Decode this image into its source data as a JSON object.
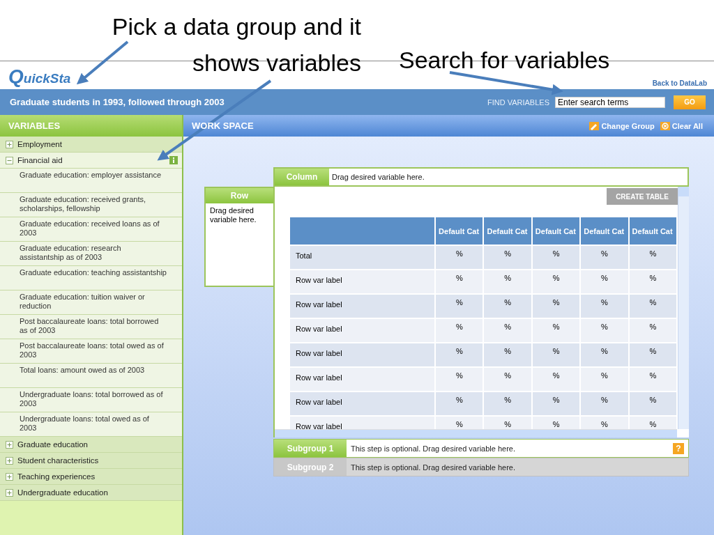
{
  "annotations": [
    {
      "kind": "group",
      "lines": [
        "Pick a data group and it",
        "shows variables"
      ]
    },
    {
      "kind": "search",
      "lines": [
        "Search for variables"
      ]
    }
  ],
  "logo": "QuickSta",
  "back_link": "Back to DataLab",
  "dataset_title": "Graduate students in 1993, followed through 2003",
  "find": {
    "label": "FIND VARIABLES",
    "value": "Enter search terms",
    "button": "GO"
  },
  "variables": {
    "title": "VARIABLES",
    "groups": [
      {
        "label": "Employment",
        "expanded": false
      },
      {
        "label": "Financial aid",
        "expanded": true,
        "children": [
          "Graduate education: employer assistance",
          "Graduate education: received grants, scholarships, fellowship",
          "Graduate education: received loans as of 2003",
          "Graduate education: research assistantship as of 2003",
          "Graduate education: teaching assistantship",
          "Graduate education: tuition waiver or reduction",
          "Post baccalaureate loans: total borrowed as of 2003",
          "Post baccalaureate loans: total owed as of 2003",
          "Total loans: amount owed as of 2003",
          "Undergraduate loans: total borrowed as of 2003",
          "Undergraduate loans: total owed as of 2003"
        ]
      },
      {
        "label": "Graduate education",
        "expanded": false
      },
      {
        "label": "Student characteristics",
        "expanded": false
      },
      {
        "label": "Teaching experiences",
        "expanded": false
      },
      {
        "label": "Undergraduate education",
        "expanded": false
      }
    ]
  },
  "workspace": {
    "title": "WORK SPACE",
    "actions": [
      {
        "kind": "change",
        "label": "Change Group"
      },
      {
        "kind": "clear",
        "label": "Clear All"
      }
    ],
    "column": {
      "label": "Column",
      "hint": "Drag desired variable here."
    },
    "row": {
      "label": "Row",
      "hint": "Drag desired variable here."
    },
    "create_table": "CREATE TABLE",
    "table": {
      "columns": [
        "Default Cat",
        "Default Cat",
        "Default Cat",
        "Default Cat",
        "Default Cat"
      ],
      "rows": [
        {
          "label": "Total",
          "cells": [
            "%",
            "%",
            "%",
            "%",
            "%"
          ]
        },
        {
          "label": "Row var label",
          "cells": [
            "%",
            "%",
            "%",
            "%",
            "%"
          ]
        },
        {
          "label": "Row var label",
          "cells": [
            "%",
            "%",
            "%",
            "%",
            "%"
          ]
        },
        {
          "label": "Row var label",
          "cells": [
            "%",
            "%",
            "%",
            "%",
            "%"
          ]
        },
        {
          "label": "Row var label",
          "cells": [
            "%",
            "%",
            "%",
            "%",
            "%"
          ]
        },
        {
          "label": "Row var label",
          "cells": [
            "%",
            "%",
            "%",
            "%",
            "%"
          ]
        },
        {
          "label": "Row var label",
          "cells": [
            "%",
            "%",
            "%",
            "%",
            "%"
          ]
        },
        {
          "label": "Row var label",
          "cells": [
            "%",
            "%",
            "%",
            "%",
            "%"
          ]
        }
      ]
    },
    "subgroups": [
      {
        "label": "Subgroup 1",
        "hint": "This step is optional. Drag desired variable here.",
        "enabled": true,
        "help": "?"
      },
      {
        "label": "Subgroup 2",
        "hint": "This step is optional. Drag desired variable here.",
        "enabled": false
      }
    ]
  }
}
